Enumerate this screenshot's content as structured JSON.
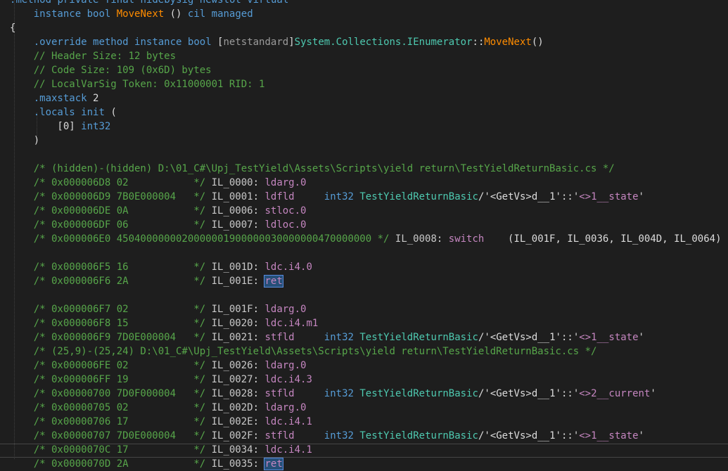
{
  "lines": [
    ".method private final hidebysig newslot virtual",
    "    instance bool MoveNext () cil managed",
    "{",
    "    .override method instance bool [netstandard]System.Collections.IEnumerator::MoveNext()",
    "    // Header Size: 12 bytes",
    "    // Code Size: 109 (0x6D) bytes",
    "    // LocalVarSig Token: 0x11000001 RID: 1",
    "    .maxstack 2",
    "    .locals init (",
    "        [0] int32",
    "    )",
    "",
    "    /* (hidden)-(hidden) D:\\01_C#\\Upj_TestYield\\Assets\\Scripts\\yield return\\TestYieldReturnBasic.cs */",
    "    /* 0x000006D8 02           */ IL_0000: ldarg.0",
    "    /* 0x000006D9 7B0E000004   */ IL_0001: ldfld     int32 TestYieldReturnBasic/'<GetVs>d__1'::'<>1__state'",
    "    /* 0x000006DE 0A           */ IL_0006: stloc.0",
    "    /* 0x000006DF 06           */ IL_0007: ldloc.0",
    "    /* 0x000006E0 4504000000020000001900000030000000470000000 */ IL_0008: switch    (IL_001F, IL_0036, IL_004D, IL_0064)",
    "",
    "    /* 0x000006F5 16           */ IL_001D: ldc.i4.0",
    "    /* 0x000006F6 2A           */ IL_001E: ret",
    "",
    "    /* 0x000006F7 02           */ IL_001F: ldarg.0",
    "    /* 0x000006F8 15           */ IL_0020: ldc.i4.m1",
    "    /* 0x000006F9 7D0E000004   */ IL_0021: stfld     int32 TestYieldReturnBasic/'<GetVs>d__1'::'<>1__state'",
    "    /* (25,9)-(25,24) D:\\01_C#\\Upj_TestYield\\Assets\\Scripts\\yield return\\TestYieldReturnBasic.cs */",
    "    /* 0x000006FE 02           */ IL_0026: ldarg.0",
    "    /* 0x000006FF 19           */ IL_0027: ldc.i4.3",
    "    /* 0x00000700 7D0F000004   */ IL_0028: stfld     int32 TestYieldReturnBasic/'<GetVs>d__1'::'<>2__current'",
    "    /* 0x00000705 02           */ IL_002D: ldarg.0",
    "    /* 0x00000706 17           */ IL_002E: ldc.i4.1",
    "    /* 0x00000707 7D0E000004   */ IL_002F: stfld     int32 TestYieldReturnBasic/'<GetVs>d__1'::'<>1__state'",
    "    /* 0x0000070C 17           */ IL_0034: ldc.i4.1",
    "    /* 0x0000070D 2A           */ IL_0035: ret"
  ],
  "colors": {
    "background": "#1e1e1e",
    "keyword": "#569cd6",
    "comment": "#57a64a",
    "type": "#4ec9b0",
    "method": "#ff8c00",
    "opcode": "#c586c0",
    "highlight": "#264f78"
  },
  "highlighted_tokens": [
    "ret",
    "ret"
  ]
}
